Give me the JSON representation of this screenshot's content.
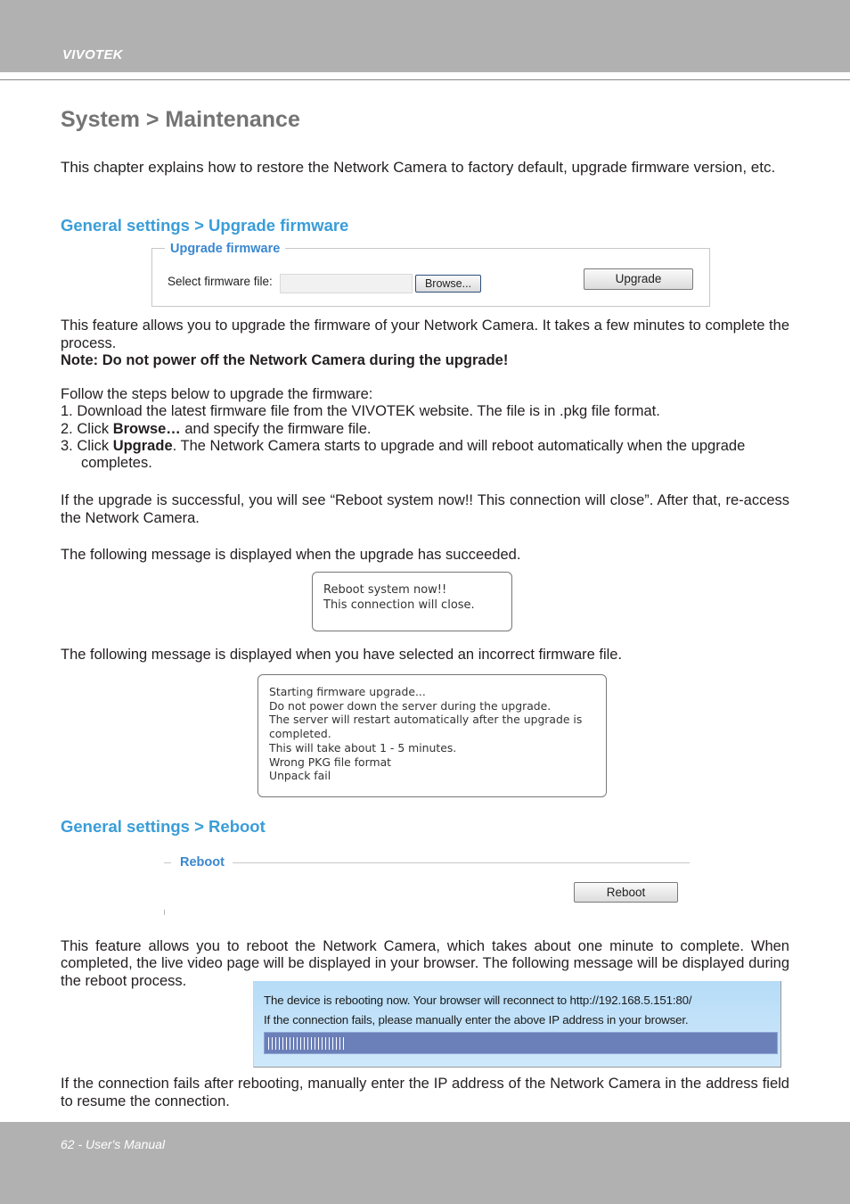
{
  "header": {
    "brand": "VIVOTEK"
  },
  "page_title": "System > Maintenance",
  "intro": "This chapter explains how to restore the Network Camera to factory default, upgrade firmware version, etc.",
  "upgrade_section": {
    "heading": "General settings > Upgrade firmware",
    "widget": {
      "legend": "Upgrade firmware",
      "file_label": "Select firmware file:",
      "file_value": "",
      "browse_label": "Browse...",
      "upgrade_label": "Upgrade"
    },
    "description": "This feature allows you to upgrade the firmware of your Network Camera. It takes a few minutes to complete the process.",
    "note": "Note: Do not power off the Network Camera during the upgrade!",
    "steps_intro": "Follow the steps below to upgrade the firmware:",
    "step1": "1. Download the latest firmware file from the VIVOTEK website. The file is in .pkg file format.",
    "step2_prefix": "2. Click ",
    "step2_bold": "Browse…",
    "step2_suffix": " and specify the firmware file.",
    "step3_prefix": "3. Click ",
    "step3_bold": "Upgrade",
    "step3_suffix": ". The Network Camera starts to upgrade and will reboot automatically when the upgrade",
    "step3_cont": "completes.",
    "success_para": "If the upgrade is successful, you will see “Reboot system now!! This connection will close”. After that, re-access the Network Camera.",
    "success_intro": "The following message is displayed when the upgrade has succeeded.",
    "success_message": [
      "Reboot system now!!",
      "This connection will close."
    ],
    "error_intro": "The following message is displayed when you have selected an incorrect firmware file.",
    "error_message": [
      "Starting firmware upgrade...",
      "Do not power down the server during the upgrade.",
      "The server will restart automatically after the upgrade is",
      "completed.",
      "This will take about 1 - 5 minutes.",
      "Wrong PKG file format",
      "Unpack fail"
    ]
  },
  "reboot_section": {
    "heading": "General settings > Reboot",
    "widget": {
      "legend": "Reboot",
      "reboot_label": "Reboot"
    },
    "description": "This feature allows you to reboot the Network Camera, which takes about one minute to complete. When completed, the live video page will be displayed in your browser. The following message will be displayed during the reboot process.",
    "notice": {
      "line1": "The device is rebooting now. Your browser will reconnect to http://192.168.5.151:80/",
      "line2": "If the connection fails, please manually enter the above IP address in your browser.",
      "progress_percent": 15
    },
    "closing": "If the connection fails after rebooting, manually enter the IP address of the Network Camera in the address field to resume the connection."
  },
  "footer": {
    "text": "62 - User's Manual"
  }
}
